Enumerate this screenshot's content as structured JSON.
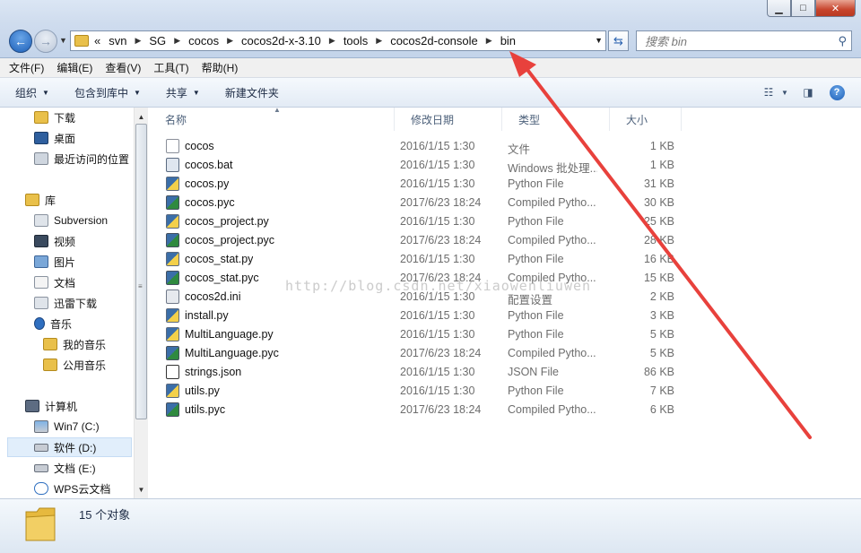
{
  "window": {
    "controls": {
      "minimize": "▁",
      "maximize": "□",
      "close": "✕"
    }
  },
  "address": {
    "overflow": "«",
    "crumbs": [
      "svn",
      "SG",
      "cocos",
      "cocos2d-x-3.10",
      "tools",
      "cocos2d-console",
      "bin"
    ]
  },
  "search": {
    "placeholder": "搜索 bin"
  },
  "menu": [
    "文件(F)",
    "编辑(E)",
    "查看(V)",
    "工具(T)",
    "帮助(H)"
  ],
  "toolbar": {
    "organize": "组织",
    "include_in_library": "包含到库中",
    "share": "共享",
    "new_folder": "新建文件夹"
  },
  "nav": {
    "downloads": "下载",
    "desktop": "桌面",
    "recent": "最近访问的位置",
    "libraries": "库",
    "subversion": "Subversion",
    "videos": "视频",
    "pictures": "图片",
    "documents": "文档",
    "thunder": "迅雷下载",
    "music": "音乐",
    "my_music": "我的音乐",
    "public_music": "公用音乐",
    "computer": "计算机",
    "drive_c": "Win7 (C:)",
    "drive_d": "软件 (D:)",
    "drive_e": "文档 (E:)",
    "wps": "WPS云文档"
  },
  "columns": {
    "name": "名称",
    "date": "修改日期",
    "type": "类型",
    "size": "大小"
  },
  "files": [
    {
      "name": "cocos",
      "date": "2016/1/15 1:30",
      "type": "文件",
      "size": "1 KB",
      "icon": "file-icon"
    },
    {
      "name": "cocos.bat",
      "date": "2016/1/15 1:30",
      "type": "Windows 批处理...",
      "size": "1 KB",
      "icon": "batch-file-icon"
    },
    {
      "name": "cocos.py",
      "date": "2016/1/15 1:30",
      "type": "Python File",
      "size": "31 KB",
      "icon": "python-file-icon"
    },
    {
      "name": "cocos.pyc",
      "date": "2017/6/23 18:24",
      "type": "Compiled Pytho...",
      "size": "30 KB",
      "icon": "compiled-python-icon"
    },
    {
      "name": "cocos_project.py",
      "date": "2016/1/15 1:30",
      "type": "Python File",
      "size": "25 KB",
      "icon": "python-file-icon"
    },
    {
      "name": "cocos_project.pyc",
      "date": "2017/6/23 18:24",
      "type": "Compiled Pytho...",
      "size": "28 KB",
      "icon": "compiled-python-icon"
    },
    {
      "name": "cocos_stat.py",
      "date": "2016/1/15 1:30",
      "type": "Python File",
      "size": "16 KB",
      "icon": "python-file-icon"
    },
    {
      "name": "cocos_stat.pyc",
      "date": "2017/6/23 18:24",
      "type": "Compiled Pytho...",
      "size": "15 KB",
      "icon": "compiled-python-icon"
    },
    {
      "name": "cocos2d.ini",
      "date": "2016/1/15 1:30",
      "type": "配置设置",
      "size": "2 KB",
      "icon": "config-file-icon"
    },
    {
      "name": "install.py",
      "date": "2016/1/15 1:30",
      "type": "Python File",
      "size": "3 KB",
      "icon": "python-file-icon"
    },
    {
      "name": "MultiLanguage.py",
      "date": "2016/1/15 1:30",
      "type": "Python File",
      "size": "5 KB",
      "icon": "python-file-icon"
    },
    {
      "name": "MultiLanguage.pyc",
      "date": "2017/6/23 18:24",
      "type": "Compiled Pytho...",
      "size": "5 KB",
      "icon": "compiled-python-icon"
    },
    {
      "name": "strings.json",
      "date": "2016/1/15 1:30",
      "type": "JSON File",
      "size": "86 KB",
      "icon": "json-file-icon"
    },
    {
      "name": "utils.py",
      "date": "2016/1/15 1:30",
      "type": "Python File",
      "size": "7 KB",
      "icon": "python-file-icon"
    },
    {
      "name": "utils.pyc",
      "date": "2017/6/23 18:24",
      "type": "Compiled Pytho...",
      "size": "6 KB",
      "icon": "compiled-python-icon"
    }
  ],
  "watermark": "http://blog.csdn.net/xiaowenliuwen",
  "status": {
    "count": "15 个对象"
  },
  "colors": {
    "annotation_arrow": "#e8413c",
    "selection": "#e1eefb"
  }
}
